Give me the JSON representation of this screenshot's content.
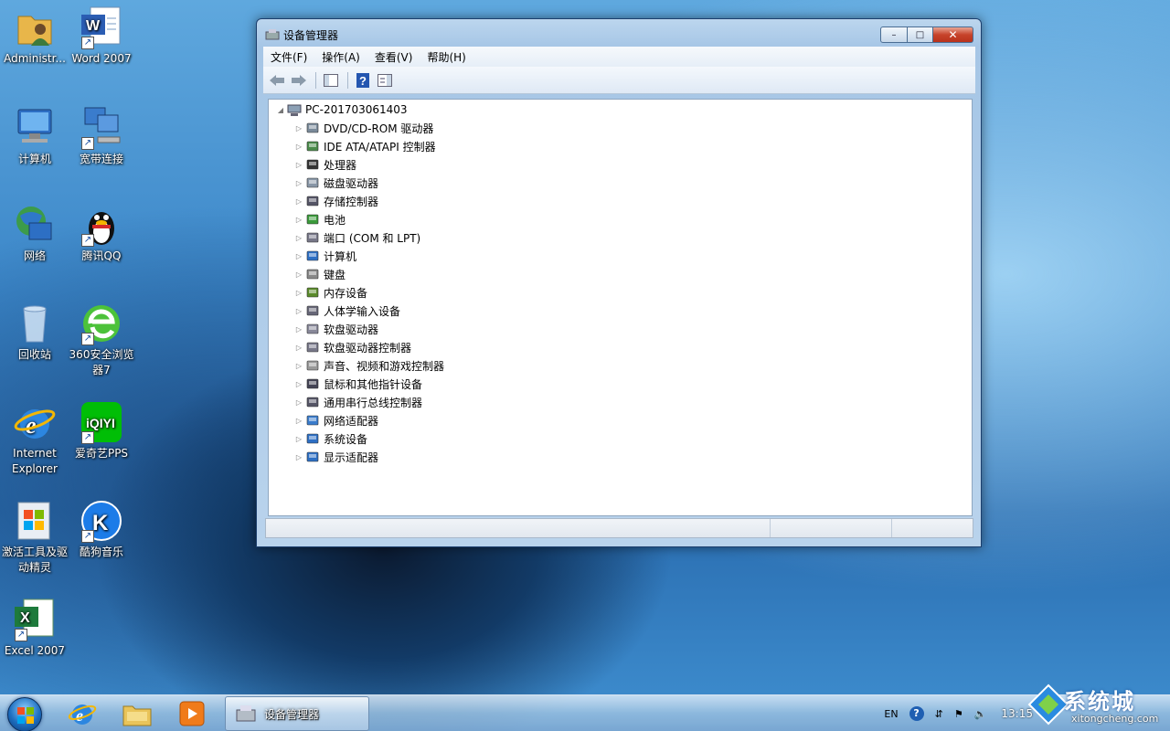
{
  "desktop": {
    "icons": [
      {
        "label": "Administr..."
      },
      {
        "label": "Word 2007"
      },
      {
        "label": "计算机"
      },
      {
        "label": "宽带连接"
      },
      {
        "label": "网络"
      },
      {
        "label": "腾讯QQ"
      },
      {
        "label": "回收站"
      },
      {
        "label": "360安全浏览器7"
      },
      {
        "label": "Internet Explorer"
      },
      {
        "label": "爱奇艺PPS"
      },
      {
        "label": "激活工具及驱动精灵"
      },
      {
        "label": "酷狗音乐"
      },
      {
        "label": "Excel 2007"
      }
    ]
  },
  "window": {
    "title": "设备管理器",
    "caption": {
      "minimize": "–",
      "maximize": "□",
      "close": "✕"
    },
    "menu": [
      "文件(F)",
      "操作(A)",
      "查看(V)",
      "帮助(H)"
    ],
    "tree": {
      "root": "PC-201703061403",
      "items": [
        {
          "label": "DVD/CD-ROM 驱动器",
          "icon": "dvd-drive-icon"
        },
        {
          "label": "IDE ATA/ATAPI 控制器",
          "icon": "ide-controller-icon"
        },
        {
          "label": "处理器",
          "icon": "processor-icon"
        },
        {
          "label": "磁盘驱动器",
          "icon": "disk-drive-icon"
        },
        {
          "label": "存储控制器",
          "icon": "storage-controller-icon"
        },
        {
          "label": "电池",
          "icon": "battery-icon"
        },
        {
          "label": "端口 (COM 和 LPT)",
          "icon": "port-icon"
        },
        {
          "label": "计算机",
          "icon": "computer-icon"
        },
        {
          "label": "键盘",
          "icon": "keyboard-icon"
        },
        {
          "label": "内存设备",
          "icon": "memory-icon"
        },
        {
          "label": "人体学输入设备",
          "icon": "hid-icon"
        },
        {
          "label": "软盘驱动器",
          "icon": "floppy-drive-icon"
        },
        {
          "label": "软盘驱动器控制器",
          "icon": "floppy-controller-icon"
        },
        {
          "label": "声音、视频和游戏控制器",
          "icon": "sound-icon"
        },
        {
          "label": "鼠标和其他指针设备",
          "icon": "mouse-icon"
        },
        {
          "label": "通用串行总线控制器",
          "icon": "usb-icon"
        },
        {
          "label": "网络适配器",
          "icon": "network-adapter-icon"
        },
        {
          "label": "系统设备",
          "icon": "system-device-icon"
        },
        {
          "label": "显示适配器",
          "icon": "display-adapter-icon"
        }
      ]
    }
  },
  "taskbar": {
    "active_task": "设备管理器",
    "tray": {
      "language": "EN",
      "clock": "13:15"
    }
  },
  "watermark": {
    "title": "系统城",
    "url": "xitongcheng.com"
  }
}
